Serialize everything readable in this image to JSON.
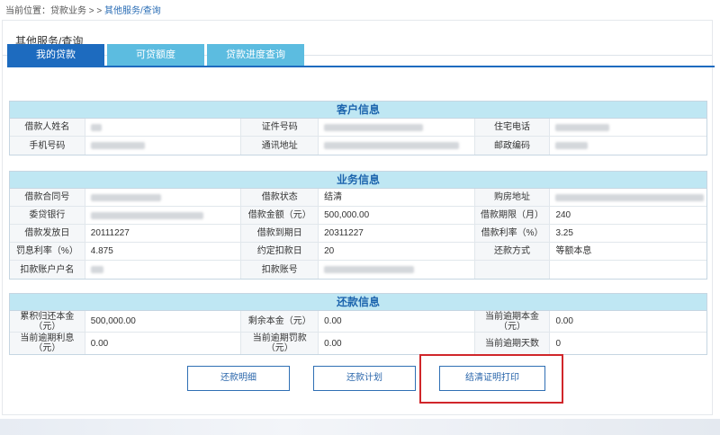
{
  "breadcrumb": {
    "prefix": "当前位置：贷款业务 > > ",
    "current": "其他服务/查询"
  },
  "panel": {
    "title": "其他服务/查询"
  },
  "tabs": [
    {
      "label": "我的贷款",
      "active": true
    },
    {
      "label": "可贷额度",
      "active": false
    },
    {
      "label": "贷款进度查询",
      "active": false
    }
  ],
  "customer": {
    "title": "客户信息",
    "rows": [
      [
        "借款人姓名",
        "",
        "证件号码",
        "",
        "住宅电话",
        ""
      ],
      [
        "手机号码",
        "",
        "通讯地址",
        "",
        "邮政编码",
        ""
      ]
    ]
  },
  "business": {
    "title": "业务信息",
    "rows": [
      [
        "借款合同号",
        "",
        "借款状态",
        "结清",
        "购房地址",
        ""
      ],
      [
        "委贷银行",
        "",
        "借款金额（元）",
        "500,000.00",
        "借款期限（月）",
        "240"
      ],
      [
        "借款发放日",
        "20111227",
        "借款到期日",
        "20311227",
        "借款利率（%）",
        "3.25"
      ],
      [
        "罚息利率（%）",
        "4.875",
        "约定扣款日",
        "20",
        "还款方式",
        "等额本息"
      ],
      [
        "扣款账户户名",
        "",
        "扣款账号",
        "",
        "",
        ""
      ]
    ]
  },
  "repayment": {
    "title": "还款信息",
    "rows": [
      [
        "累积归还本金（元）",
        "500,000.00",
        "剩余本金（元）",
        "0.00",
        "当前逾期本金（元）",
        "0.00"
      ],
      [
        "当前逾期利息（元）",
        "0.00",
        "当前逾期罚款（元）",
        "0.00",
        "当前逾期天数",
        "0"
      ]
    ]
  },
  "buttons": {
    "details": "还款明细",
    "plan": "还款计划",
    "print": "结清证明打印"
  },
  "colors": {
    "tab_active": "#1d6bbf",
    "tab_inactive": "#5cbce0",
    "section_header": "#bfe7f3",
    "highlight_box": "#d0262a"
  }
}
